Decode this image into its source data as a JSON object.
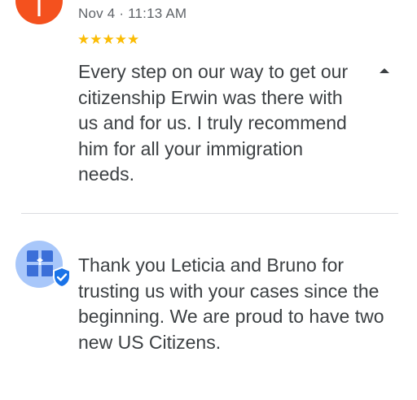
{
  "review": {
    "reviewer_initial": "T",
    "reviewer_avatar_color": "#f4511e",
    "date": "Nov 4 · 11:13 AM",
    "rating": 5,
    "stars": "★★★★★",
    "text": "Every step on our way to get our citizenship Erwin was there with us and for us. I truly recommend him for all your immigration needs.",
    "collapse_icon": "chevron-up-icon"
  },
  "owner_response": {
    "avatar_icon": "business-logo-icon",
    "badge_icon": "verified-shield-icon",
    "text": "Thank you Leticia and Bruno for trusting us with your cases since the beginning. We are proud to have two new US Citizens."
  },
  "colors": {
    "star": "#fbbc04",
    "text": "#3c4043",
    "meta": "#5f6368",
    "badge": "#1a73e8",
    "owner_avatar_bg": "#a8c7fa"
  }
}
